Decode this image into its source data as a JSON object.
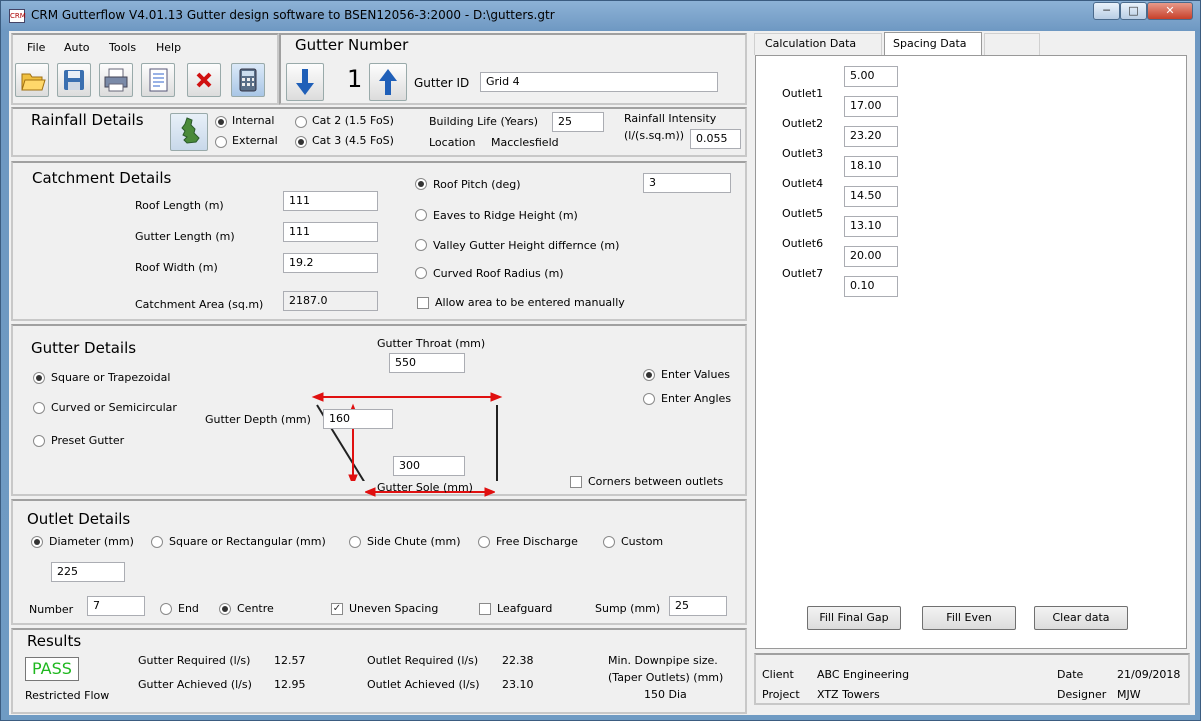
{
  "window": {
    "title": "CRM Gutterflow V4.01.13 Gutter design software to BSEN12056-3:2000 - D:\\gutters.gtr",
    "icon_text": "CRM"
  },
  "menu": {
    "items": [
      "File",
      "Auto",
      "Tools",
      "Help"
    ]
  },
  "toolbar": {
    "icons": [
      "open-folder-icon",
      "save-icon",
      "print-icon",
      "report-icon",
      "delete-icon",
      "calculator-icon"
    ]
  },
  "gutter_number": {
    "heading": "Gutter Number",
    "value": "1",
    "id_label": "Gutter ID",
    "id_value": "Grid 4"
  },
  "rainfall": {
    "heading": "Rainfall Details",
    "internal_label": "Internal",
    "external_label": "External",
    "cat2_label": "Cat 2 (1.5 FoS)",
    "cat3_label": "Cat 3 (4.5 FoS)",
    "building_life_label": "Building Life (Years)",
    "building_life_value": "25",
    "location_label": "Location",
    "location_value": "Macclesfield",
    "intensity_label_1": "Rainfall Intensity",
    "intensity_label_2": "(l/(s.sq.m))",
    "intensity_value": "0.055"
  },
  "catchment": {
    "heading": "Catchment Details",
    "roof_length_label": "Roof Length (m)",
    "roof_length_value": "111",
    "gutter_length_label": "Gutter Length (m)",
    "gutter_length_value": "111",
    "roof_width_label": "Roof Width (m)",
    "roof_width_value": "19.2",
    "area_label": "Catchment Area (sq.m)",
    "area_value": "2187.0",
    "roof_pitch_label": "Roof Pitch (deg)",
    "roof_pitch_value": "3",
    "eaves_label": "Eaves to Ridge Height (m)",
    "valley_label": "Valley Gutter Height differnce (m)",
    "curved_label": "Curved Roof Radius (m)",
    "manual_label": "Allow area to be entered manually"
  },
  "gutter": {
    "heading": "Gutter Details",
    "square_label": "Square or Trapezoidal",
    "curved_label": "Curved or Semicircular",
    "preset_label": "Preset Gutter",
    "throat_label": "Gutter Throat (mm)",
    "throat_value": "550",
    "depth_label": "Gutter Depth (mm)",
    "depth_value": "160",
    "sole_label": "Gutter Sole (mm)",
    "sole_value": "300",
    "enter_values_label": "Enter Values",
    "enter_angles_label": "Enter Angles",
    "corners_label": "Corners between outlets",
    "diagram_color": "#e01010"
  },
  "outlet": {
    "heading": "Outlet Details",
    "diameter_label": "Diameter (mm)",
    "square_label": "Square or Rectangular (mm)",
    "side_chute_label": "Side Chute (mm)",
    "free_label": "Free Discharge",
    "custom_label": "Custom",
    "diameter_value": "225",
    "number_label": "Number",
    "number_value": "7",
    "end_label": "End",
    "centre_label": "Centre",
    "uneven_label": "Uneven Spacing",
    "leafguard_label": "Leafguard",
    "sump_label": "Sump (mm)",
    "sump_value": "25"
  },
  "results": {
    "heading": "Results",
    "status": "PASS",
    "status_color": "#1fb81f",
    "restricted": "Restricted Flow",
    "gutter_req_label": "Gutter Required (l/s)",
    "gutter_req_value": "12.57",
    "gutter_ach_label": "Gutter Achieved (l/s)",
    "gutter_ach_value": "12.95",
    "outlet_req_label": "Outlet Required (l/s)",
    "outlet_req_value": "22.38",
    "outlet_ach_label": "Outlet Achieved (l/s)",
    "outlet_ach_value": "23.10",
    "downpipe_label_1": "Min. Downpipe size.",
    "downpipe_label_2": "(Taper Outlets) (mm)",
    "downpipe_value": "150 Dia"
  },
  "tabs": [
    "Calculation Data",
    "Spacing Data"
  ],
  "spacing": {
    "values": [
      "5.00",
      "17.00",
      "23.20",
      "18.10",
      "14.50",
      "13.10",
      "20.00",
      "0.10"
    ],
    "outlets": [
      "Outlet1",
      "Outlet2",
      "Outlet3",
      "Outlet4",
      "Outlet5",
      "Outlet6",
      "Outlet7"
    ],
    "fill_final_label": "Fill Final Gap",
    "fill_even_label": "Fill Even",
    "clear_label": "Clear data"
  },
  "footer": {
    "client_label": "Client",
    "client_value": "ABC Engineering",
    "project_label": "Project",
    "project_value": "XTZ Towers",
    "date_label": "Date",
    "date_value": "21/09/2018",
    "designer_label": "Designer",
    "designer_value": "MJW"
  }
}
